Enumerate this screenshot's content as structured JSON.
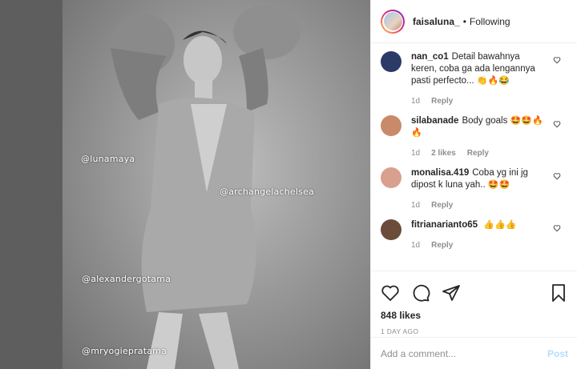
{
  "post": {
    "image_tags": [
      "@lunamaya",
      "@archangelachelsea",
      "@alexandergotama",
      "@mryogiepratama"
    ]
  },
  "header": {
    "username": "faisaluna_",
    "separator": "•",
    "follow_status": "Following"
  },
  "comments": [
    {
      "username": "nan_co1",
      "text": "Detail bawahnya keren, coba ga ada lengannya pasti perfecto...",
      "emoji": "👏🔥😂",
      "age": "1d",
      "likes": "",
      "reply": "Reply",
      "avatar_color": "#2b3a67"
    },
    {
      "username": "silabanade",
      "text": "Body goals",
      "emoji": "🤩🤩🔥🔥",
      "age": "1d",
      "likes": "2 likes",
      "reply": "Reply",
      "avatar_color": "#c98a6a"
    },
    {
      "username": "monalisa.419",
      "text": "Coba yg ini jg dipost k luna yah..",
      "emoji": "🤩🤩",
      "age": "1d",
      "likes": "",
      "reply": "Reply",
      "avatar_color": "#d8a08f"
    },
    {
      "username": "fitrianarianto65",
      "text": "",
      "emoji": "👍👍👍",
      "age": "1d",
      "likes": "",
      "reply": "Reply",
      "avatar_color": "#6b4b3a"
    }
  ],
  "actions": {
    "likes_count": "848 likes",
    "time_ago": "1 DAY AGO"
  },
  "add_comment": {
    "placeholder": "Add a comment...",
    "post_label": "Post"
  }
}
